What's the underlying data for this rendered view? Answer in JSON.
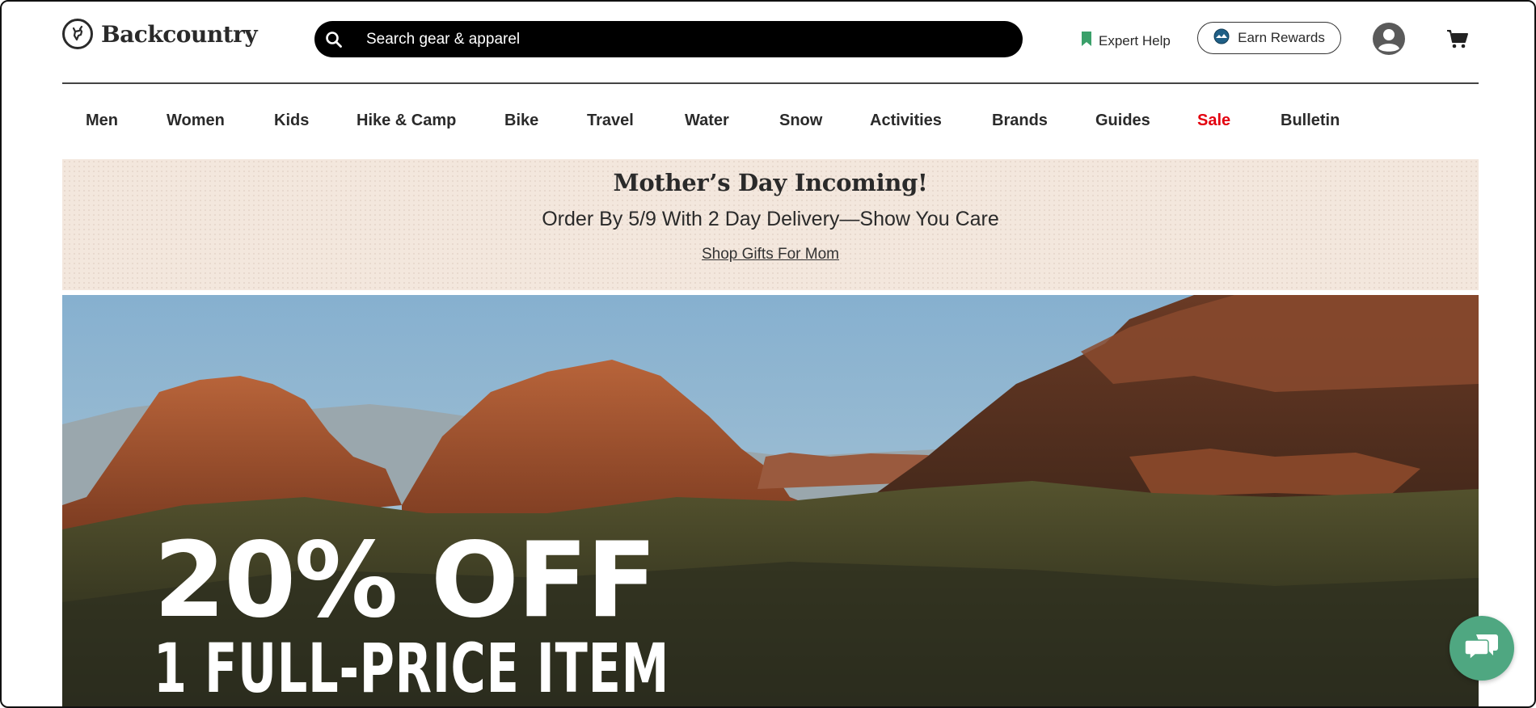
{
  "header": {
    "logo_text": "Backcountry",
    "search_placeholder": "Search gear & apparel",
    "expert_help_label": "Expert Help",
    "earn_rewards_label": "Earn Rewards"
  },
  "nav": {
    "items": [
      {
        "label": "Men"
      },
      {
        "label": "Women"
      },
      {
        "label": "Kids"
      },
      {
        "label": "Hike & Camp"
      },
      {
        "label": "Bike"
      },
      {
        "label": "Travel"
      },
      {
        "label": "Water"
      },
      {
        "label": "Snow"
      },
      {
        "label": "Activities"
      },
      {
        "label": "Brands"
      },
      {
        "label": "Guides"
      },
      {
        "label": "Sale"
      },
      {
        "label": "Bulletin"
      }
    ]
  },
  "promo": {
    "title": "Mother’s Day Incoming!",
    "subtitle": "Order By 5/9 With 2 Day Delivery—Show You Care",
    "link": "Shop Gifts For Mom"
  },
  "hero": {
    "headline": "20% OFF",
    "subheadline": "1 FULL-PRICE ITEM"
  },
  "colors": {
    "accent_green": "#4fa781",
    "sale_red": "#e3000f",
    "promo_bg": "#f3e7dd",
    "search_bg": "#000000"
  },
  "icons": {
    "logo": "goat-logo-icon",
    "search": "search-icon",
    "expert_help": "bookmark-icon",
    "rewards": "rewards-badge-icon",
    "account": "account-icon",
    "cart": "cart-icon",
    "chat": "chat-icon"
  }
}
